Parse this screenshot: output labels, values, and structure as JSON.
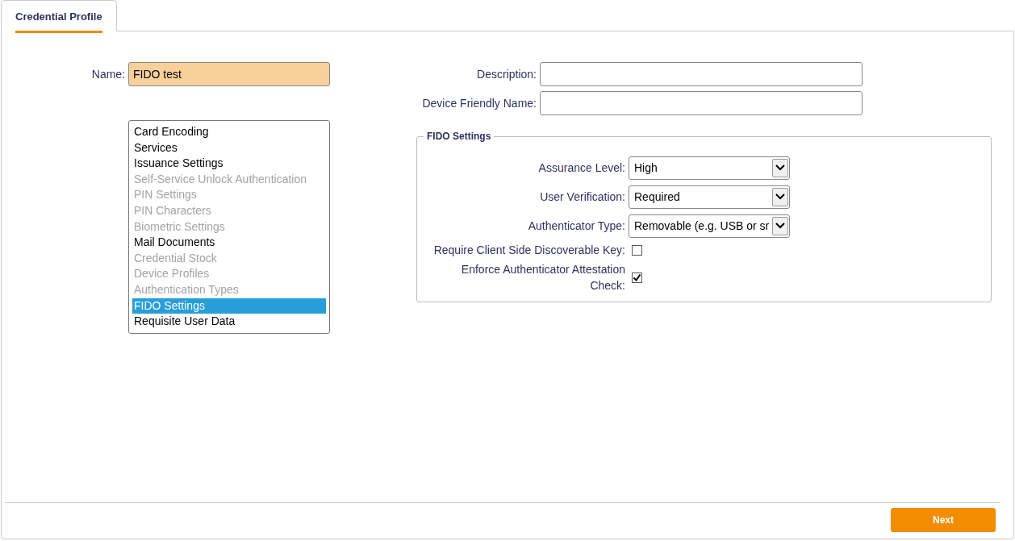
{
  "tabs": [
    {
      "label": "Credential Profile",
      "selected": true
    }
  ],
  "name_field": {
    "label": "Name:",
    "value": "FIDO test"
  },
  "sections": [
    {
      "label": "Card Encoding",
      "disabled": false,
      "selected": false
    },
    {
      "label": "Services",
      "disabled": false,
      "selected": false
    },
    {
      "label": "Issuance Settings",
      "disabled": false,
      "selected": false
    },
    {
      "label": "Self-Service Unlock Authentication",
      "disabled": true,
      "selected": false
    },
    {
      "label": "PIN Settings",
      "disabled": true,
      "selected": false
    },
    {
      "label": "PIN Characters",
      "disabled": true,
      "selected": false
    },
    {
      "label": "Biometric Settings",
      "disabled": true,
      "selected": false
    },
    {
      "label": "Mail Documents",
      "disabled": false,
      "selected": false
    },
    {
      "label": "Credential Stock",
      "disabled": true,
      "selected": false
    },
    {
      "label": "Device Profiles",
      "disabled": true,
      "selected": false
    },
    {
      "label": "Authentication Types",
      "disabled": true,
      "selected": false
    },
    {
      "label": "FIDO Settings",
      "disabled": false,
      "selected": true
    },
    {
      "label": "Requisite User Data",
      "disabled": false,
      "selected": false
    }
  ],
  "text_fields": [
    {
      "label": "Description:"
    },
    {
      "label": "Device Friendly Name:"
    }
  ],
  "fido_settings": {
    "title": "FIDO Settings",
    "fields": [
      {
        "kind": "select",
        "label": "Assurance Level:",
        "value": "High"
      },
      {
        "kind": "select",
        "label": "User Verification:",
        "value": "Required"
      },
      {
        "kind": "select",
        "label": "Authenticator Type:",
        "value": "Removable (e.g. USB or sr"
      },
      {
        "kind": "checkbox",
        "label": "Require Client Side Discoverable Key:",
        "checked": false
      },
      {
        "kind": "checkbox",
        "label": "Enforce Authenticator Attestation Check:",
        "checked": true
      }
    ]
  },
  "buttons": [
    "Next"
  ]
}
